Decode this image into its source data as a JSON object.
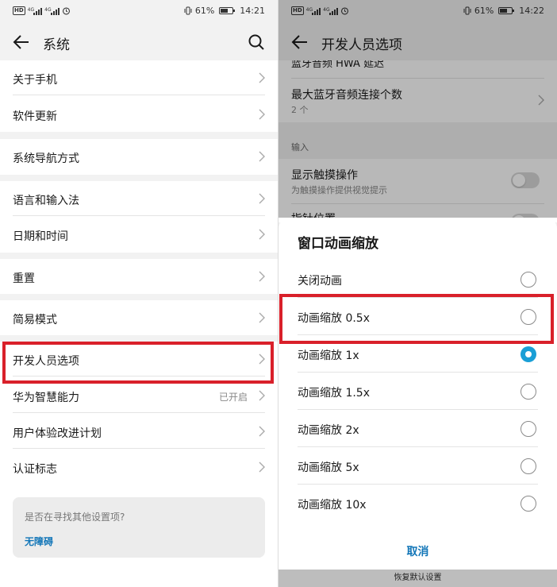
{
  "left": {
    "status": {
      "icons_text": "HD",
      "net1": "4G",
      "net2": "4G",
      "battery": "61%",
      "time": "14:21"
    },
    "header": {
      "title": "系统"
    },
    "groups": [
      [
        {
          "label": "关于手机"
        },
        {
          "label": "软件更新"
        }
      ],
      [
        {
          "label": "系统导航方式"
        }
      ],
      [
        {
          "label": "语言和输入法"
        },
        {
          "label": "日期和时间"
        }
      ],
      [
        {
          "label": "重置"
        }
      ],
      [
        {
          "label": "简易模式"
        }
      ],
      [
        {
          "label": "开发人员选项"
        },
        {
          "label": "华为智慧能力",
          "value": "已开启"
        },
        {
          "label": "用户体验改进计划"
        },
        {
          "label": "认证标志"
        }
      ]
    ],
    "help": {
      "question": "是否在寻找其他设置项?",
      "link": "无障碍"
    }
  },
  "right": {
    "status": {
      "icons_text": "HD",
      "net1": "4G",
      "net2": "4G",
      "battery": "61%",
      "time": "14:22"
    },
    "header": {
      "title": "开发人员选项"
    },
    "bg": {
      "partial_top": "蓝牙音频 HWA 延迟",
      "max_bt": {
        "label": "最大蓝牙音频连接个数",
        "sub": "2 个"
      },
      "section_input": "输入",
      "show_touch": {
        "label": "显示触摸操作",
        "sub": "为触摸操作提供视觉提示"
      },
      "pointer": {
        "label": "指针位置"
      }
    },
    "dialog": {
      "title": "窗口动画缩放",
      "options": [
        "关闭动画",
        "动画缩放 0.5x",
        "动画缩放 1x",
        "动画缩放 1.5x",
        "动画缩放 2x",
        "动画缩放 5x",
        "动画缩放 10x"
      ],
      "selected_index": 2,
      "cancel": "取消"
    },
    "bottom_hint": "恢复默认设置"
  },
  "colors": {
    "accent": "#1276b8",
    "radio_selected": "#1a9fd6",
    "highlight_box": "#d9202a"
  }
}
